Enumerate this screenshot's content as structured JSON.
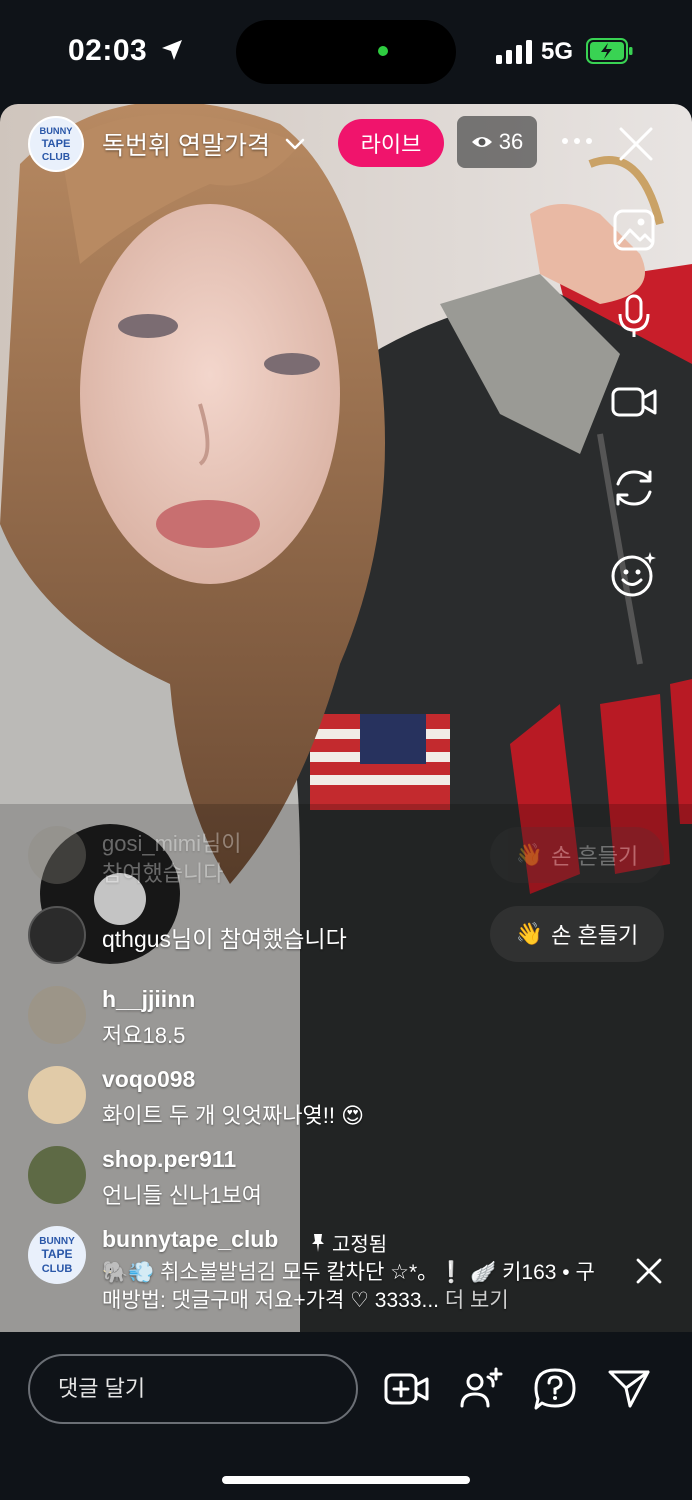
{
  "status": {
    "time": "02:03",
    "network": "5G"
  },
  "header": {
    "title": "독번휘 연말가격",
    "live_label": "라이브",
    "viewer_count": "36",
    "avatar_text": [
      "BUNNY",
      "TAPE",
      "CLUB"
    ]
  },
  "comments": [
    {
      "user": "gosi_mimi님이",
      "text": "참여했습니다",
      "faded": true
    },
    {
      "user": "qthgus님이 참여했습니다",
      "text": ""
    },
    {
      "user": "h__jjiinn",
      "text": "저요18.5"
    },
    {
      "user": "voqo098",
      "text": "화이트 두 개 잇엇짜나옂!! 😍"
    },
    {
      "user": "shop.per911",
      "text": "언니들 신나1보여"
    }
  ],
  "wave_buttons": [
    {
      "label": "손 흔들기",
      "emoji": "👋"
    },
    {
      "label": "손 흔들기",
      "emoji": "👋"
    }
  ],
  "pinned": {
    "user": "bunnytape_club",
    "tag": "고정됨",
    "line1": "🐘💨 취소불발넘김 모두 칼차단 ☆*。❕ 🪽 키163 • 구",
    "line2": "매방법: 댓글구매 저요+가격 ♡ 3333...",
    "more": "더 보기"
  },
  "bottom": {
    "comment_placeholder": "댓글 달기"
  },
  "colors": {
    "live": "#f0146c",
    "bg": "#0f1318"
  }
}
